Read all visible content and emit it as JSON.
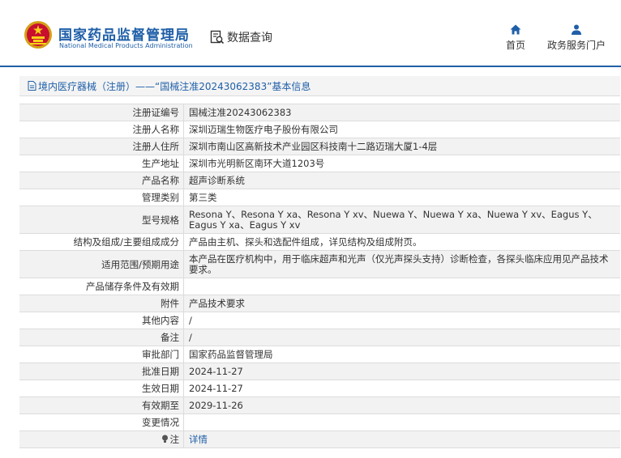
{
  "header": {
    "logo_cn": "国家药品监督管理局",
    "logo_en": "National Medical Products Administration",
    "data_query": "数据查询",
    "nav": [
      {
        "label": "首页",
        "icon": "home-icon"
      },
      {
        "label": "政务服务门户",
        "icon": "user-icon"
      }
    ]
  },
  "breadcrumb": {
    "text": "境内医疗器械（注册）——“国械注准20243062383”基本信息"
  },
  "colors": {
    "brand": "#1f5fa8",
    "row_alt": "#f2f2f2",
    "border": "#dcdcdc"
  },
  "rows": [
    {
      "label": "注册证编号",
      "value": "国械注准20243062383"
    },
    {
      "label": "注册人名称",
      "value": "深圳迈瑞生物医疗电子股份有限公司"
    },
    {
      "label": "注册人住所",
      "value": "深圳市南山区高新技术产业园区科技南十二路迈瑞大厦1-4层"
    },
    {
      "label": "生产地址",
      "value": "深圳市光明新区南环大道1203号"
    },
    {
      "label": "产品名称",
      "value": "超声诊断系统"
    },
    {
      "label": "管理类别",
      "value": "第三类"
    },
    {
      "label": "型号规格",
      "value": "Resona Y、Resona Y xa、Resona Y xv、Nuewa Y、Nuewa Y xa、Nuewa Y xv、Eagus Y、Eagus Y xa、Eagus Y xv"
    },
    {
      "label": "结构及组成/主要组成成分",
      "value": "产品由主机、探头和选配件组成，详见结构及组成附页。"
    },
    {
      "label": "适用范围/预期用途",
      "value": "本产品在医疗机构中，用于临床超声和光声（仅光声探头支持）诊断检查，各探头临床应用见产品技术要求。"
    },
    {
      "label": "产品储存条件及有效期",
      "value": ""
    },
    {
      "label": "附件",
      "value": "产品技术要求"
    },
    {
      "label": "其他内容",
      "value": "/"
    },
    {
      "label": "备注",
      "value": "/"
    },
    {
      "label": "审批部门",
      "value": "国家药品监督管理局"
    },
    {
      "label": "批准日期",
      "value": "2024-11-27"
    },
    {
      "label": "生效日期",
      "value": "2024-11-27"
    },
    {
      "label": "有效期至",
      "value": "2029-11-26"
    },
    {
      "label": "变更情况",
      "value": ""
    },
    {
      "label": "注",
      "value": "详情",
      "is_link": true,
      "icon": "lightbulb-icon"
    }
  ]
}
